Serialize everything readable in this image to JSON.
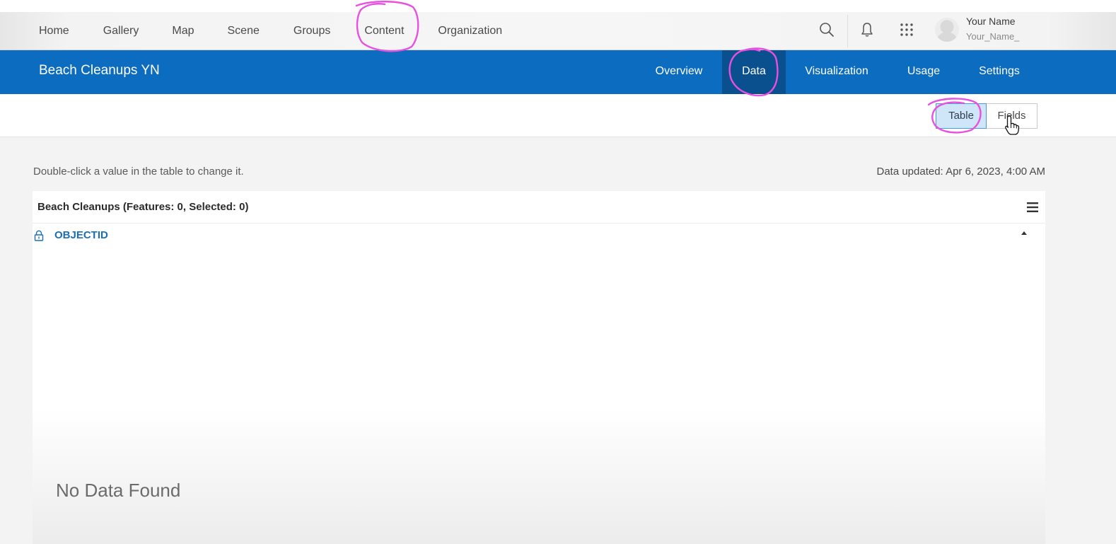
{
  "top_nav": {
    "links": [
      "Home",
      "Gallery",
      "Map",
      "Scene",
      "Groups",
      "Content",
      "Organization"
    ],
    "icons": [
      "search-icon",
      "bell-icon",
      "apps-grid-icon"
    ],
    "user": {
      "name": "Your Name",
      "handle": "Your_Name_"
    }
  },
  "item": {
    "title": "Beach Cleanups YN",
    "tabs": [
      {
        "label": "Overview",
        "active": false
      },
      {
        "label": "Data",
        "active": true
      },
      {
        "label": "Visualization",
        "active": false
      },
      {
        "label": "Usage",
        "active": false
      },
      {
        "label": "Settings",
        "active": false
      }
    ]
  },
  "view_toggle": {
    "options": [
      "Table",
      "Fields"
    ],
    "selected": "Table"
  },
  "info": {
    "hint": "Double-click a value in the table to change it.",
    "updated": "Data updated: Apr 6, 2023, 4:00 AM"
  },
  "table": {
    "title": "Beach Cleanups (Features: 0, Selected: 0)",
    "columns": [
      {
        "name": "OBJECTID",
        "locked": true
      }
    ],
    "empty_message": "No Data Found"
  },
  "colors": {
    "brand_blue": "#0c6cbf",
    "active_tab": "#0a4f8e",
    "link_blue": "#1a6fb3",
    "annotation_pink": "#e94fe0",
    "selected_toggle": "#cfe6f8"
  }
}
